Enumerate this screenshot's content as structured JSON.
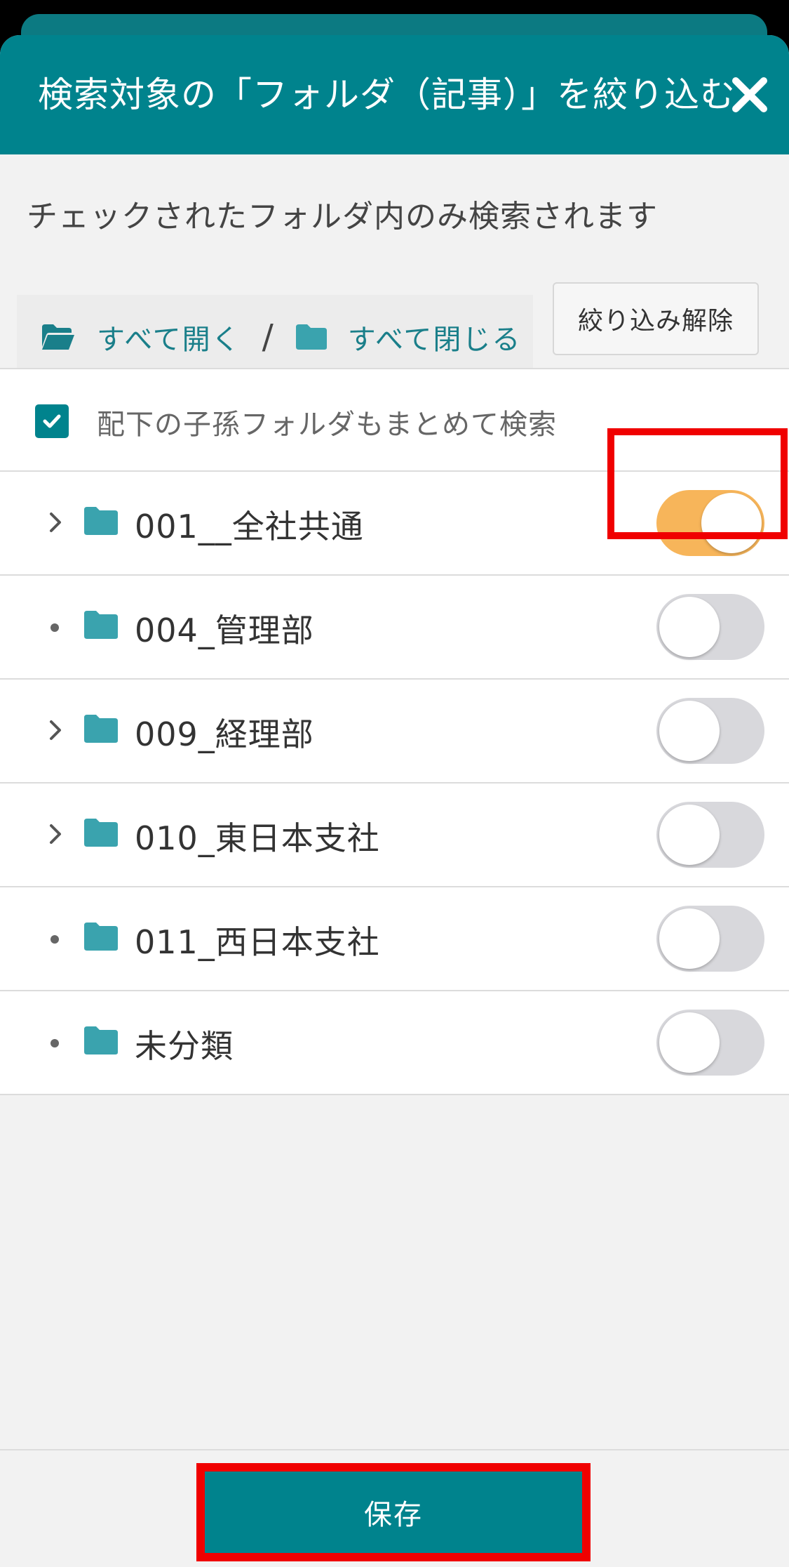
{
  "header": {
    "title": "検索対象の「フォルダ（記事）」を絞り込む"
  },
  "subtitle": "チェックされたフォルダ内のみ検索されます",
  "toolbar": {
    "expand_all": "すべて開く",
    "separator": "/",
    "collapse_all": "すべて閉じる",
    "reset": "絞り込み解除"
  },
  "include_descendants": {
    "label": "配下の子孫フォルダもまとめて検索",
    "checked": true
  },
  "folders": [
    {
      "label": "001__全社共通",
      "expandable": true,
      "enabled": true
    },
    {
      "label": "004_管理部",
      "expandable": false,
      "enabled": false
    },
    {
      "label": "009_経理部",
      "expandable": true,
      "enabled": false
    },
    {
      "label": "010_東日本支社",
      "expandable": true,
      "enabled": false
    },
    {
      "label": "011_西日本支社",
      "expandable": false,
      "enabled": false
    },
    {
      "label": "未分類",
      "expandable": false,
      "enabled": false
    }
  ],
  "footer": {
    "save": "保存"
  },
  "colors": {
    "primary": "#00838d",
    "folder": "#3aa3ae",
    "toggle_on": "#f7b55a",
    "toggle_off": "#d8d8dc",
    "highlight": "#f00000"
  }
}
